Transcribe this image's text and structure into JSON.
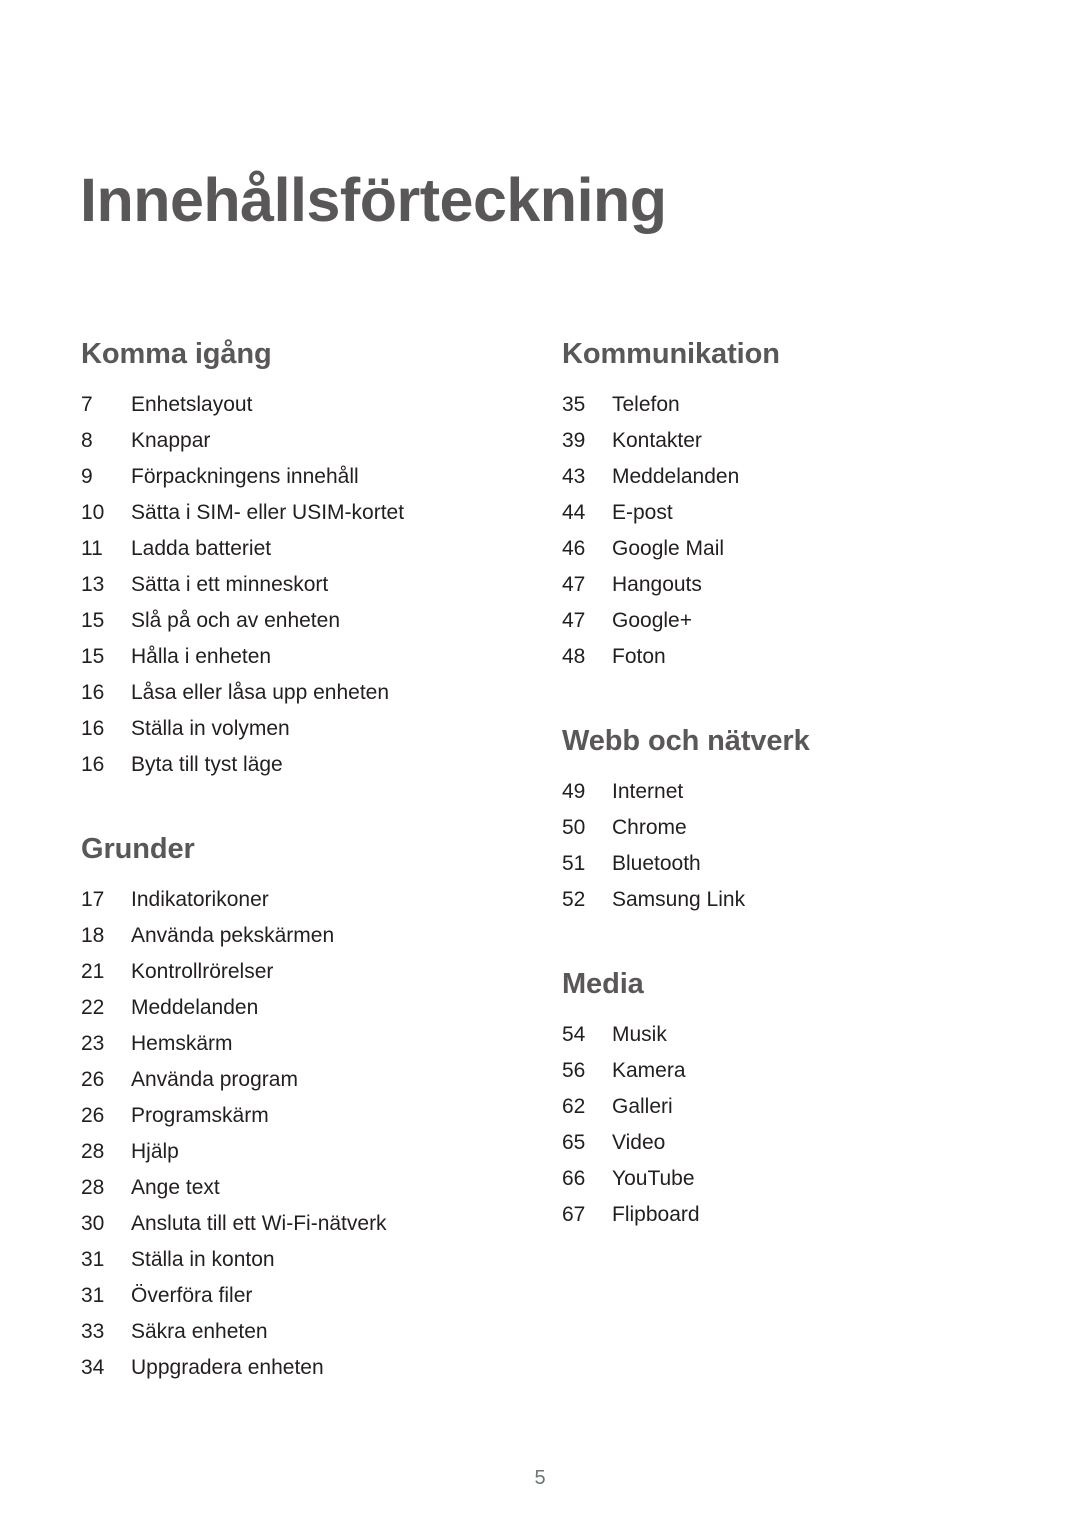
{
  "document": {
    "title": "Innehållsförteckning",
    "page_number": "5",
    "title_color": "#595757",
    "heading_color": "#595757",
    "text_color": "#231f20",
    "page_number_color": "#6b7577",
    "background_color": "#ffffff"
  },
  "columns": [
    {
      "name": "left-column",
      "sections": [
        {
          "heading": "Komma igång",
          "entries": [
            {
              "page": "7",
              "label": "Enhetslayout"
            },
            {
              "page": "8",
              "label": "Knappar"
            },
            {
              "page": "9",
              "label": "Förpackningens innehåll"
            },
            {
              "page": "10",
              "label": "Sätta i SIM- eller USIM-kortet"
            },
            {
              "page": "11",
              "label": "Ladda batteriet"
            },
            {
              "page": "13",
              "label": "Sätta i ett minneskort"
            },
            {
              "page": "15",
              "label": "Slå på och av enheten"
            },
            {
              "page": "15",
              "label": "Hålla i enheten"
            },
            {
              "page": "16",
              "label": "Låsa eller låsa upp enheten"
            },
            {
              "page": "16",
              "label": "Ställa in volymen"
            },
            {
              "page": "16",
              "label": "Byta till tyst läge"
            }
          ]
        },
        {
          "heading": "Grunder",
          "entries": [
            {
              "page": "17",
              "label": "Indikatorikoner"
            },
            {
              "page": "18",
              "label": "Använda pekskärmen"
            },
            {
              "page": "21",
              "label": "Kontrollrörelser"
            },
            {
              "page": "22",
              "label": "Meddelanden"
            },
            {
              "page": "23",
              "label": "Hemskärm"
            },
            {
              "page": "26",
              "label": "Använda program"
            },
            {
              "page": "26",
              "label": "Programskärm"
            },
            {
              "page": "28",
              "label": "Hjälp"
            },
            {
              "page": "28",
              "label": "Ange text"
            },
            {
              "page": "30",
              "label": "Ansluta till ett Wi-Fi-nätverk"
            },
            {
              "page": "31",
              "label": "Ställa in konton"
            },
            {
              "page": "31",
              "label": "Överföra filer"
            },
            {
              "page": "33",
              "label": "Säkra enheten"
            },
            {
              "page": "34",
              "label": "Uppgradera enheten"
            }
          ]
        }
      ]
    },
    {
      "name": "right-column",
      "sections": [
        {
          "heading": "Kommunikation",
          "entries": [
            {
              "page": "35",
              "label": "Telefon"
            },
            {
              "page": "39",
              "label": "Kontakter"
            },
            {
              "page": "43",
              "label": "Meddelanden"
            },
            {
              "page": "44",
              "label": "E-post"
            },
            {
              "page": "46",
              "label": "Google Mail"
            },
            {
              "page": "47",
              "label": "Hangouts"
            },
            {
              "page": "47",
              "label": "Google+"
            },
            {
              "page": "48",
              "label": "Foton"
            }
          ]
        },
        {
          "heading": "Webb och nätverk",
          "entries": [
            {
              "page": "49",
              "label": "Internet"
            },
            {
              "page": "50",
              "label": "Chrome"
            },
            {
              "page": "51",
              "label": "Bluetooth"
            },
            {
              "page": "52",
              "label": "Samsung Link"
            }
          ]
        },
        {
          "heading": "Media",
          "entries": [
            {
              "page": "54",
              "label": "Musik"
            },
            {
              "page": "56",
              "label": "Kamera"
            },
            {
              "page": "62",
              "label": "Galleri"
            },
            {
              "page": "65",
              "label": "Video"
            },
            {
              "page": "66",
              "label": "YouTube"
            },
            {
              "page": "67",
              "label": "Flipboard"
            }
          ]
        }
      ]
    }
  ]
}
